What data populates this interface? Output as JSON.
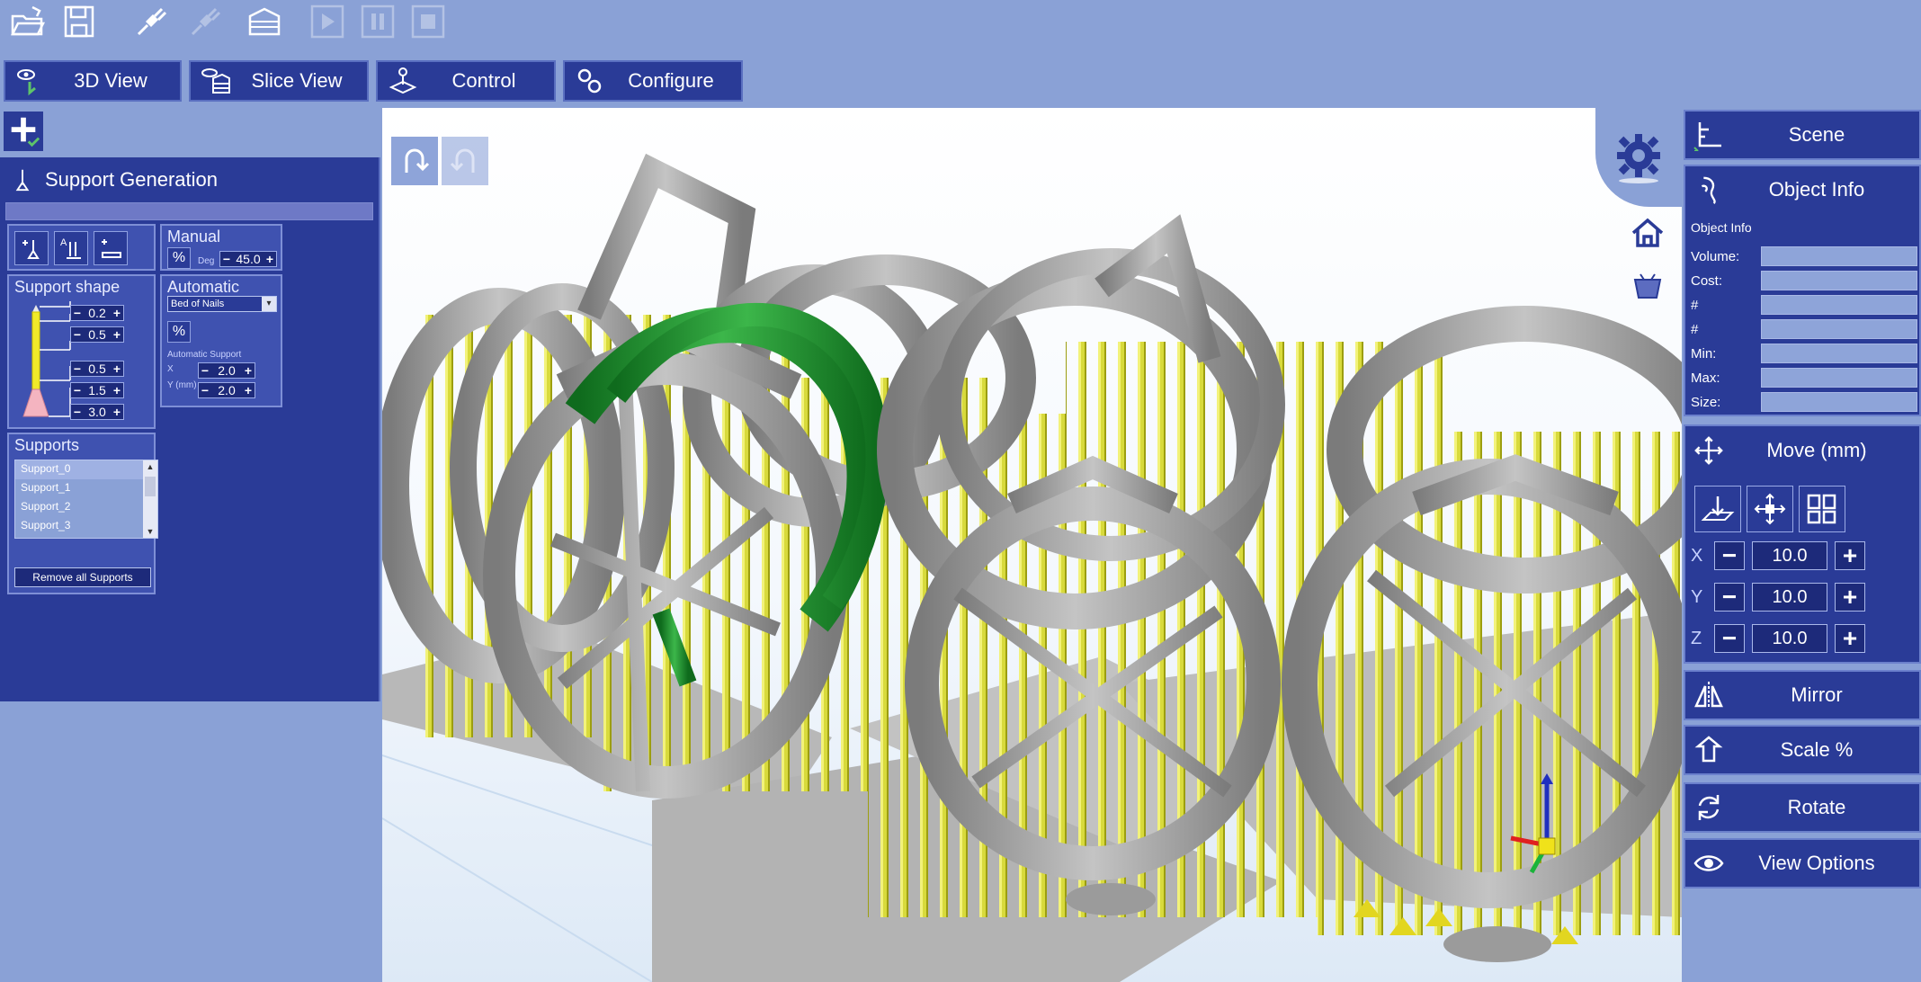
{
  "toolbar": {
    "buttons": [
      {
        "name": "open-folder-icon",
        "enabled": true
      },
      {
        "name": "save-icon",
        "enabled": true
      },
      {
        "name": "connect-icon",
        "enabled": true
      },
      {
        "name": "disconnect-icon",
        "enabled": false
      },
      {
        "name": "slice-layers-icon",
        "enabled": true
      },
      {
        "name": "play-icon",
        "enabled": false
      },
      {
        "name": "pause-icon",
        "enabled": false
      },
      {
        "name": "stop-icon",
        "enabled": false
      }
    ]
  },
  "tabs": [
    {
      "label": "3D View",
      "icon": "eye-icon"
    },
    {
      "label": "Slice View",
      "icon": "slice-icon"
    },
    {
      "label": "Control",
      "icon": "joystick-icon"
    },
    {
      "label": "Configure",
      "icon": "gears-icon"
    }
  ],
  "support_panel": {
    "title": "Support Generation",
    "support_shape": {
      "title": "Support shape",
      "values": [
        "0.2",
        "0.5",
        "0.5",
        "1.5",
        "3.0"
      ]
    },
    "manual": {
      "title": "Manual",
      "deg_label": "Deg",
      "deg_value": "45.0"
    },
    "automatic": {
      "title": "Automatic",
      "mode": "Bed of Nails",
      "auto_support_label": "Automatic Support",
      "x_label": "X",
      "y_label": "Y (mm)",
      "x_value": "2.0",
      "y_value": "2.0"
    },
    "supports": {
      "title": "Supports",
      "items": [
        "Support_0",
        "Support_1",
        "Support_2",
        "Support_3"
      ],
      "remove_label": "Remove all Supports"
    }
  },
  "right_panel": {
    "scene_label": "Scene",
    "object_info": {
      "title": "Object Info",
      "subtitle": "Object Info",
      "fields": [
        "Volume:",
        "Cost:",
        "#",
        "#",
        "Min:",
        "Max:",
        "Size:"
      ]
    },
    "move": {
      "title": "Move (mm)",
      "x_label": "X",
      "x_value": "10.0",
      "y_label": "Y",
      "y_value": "10.0",
      "z_label": "Z",
      "z_value": "10.0"
    },
    "mirror_label": "Mirror",
    "scale_label": "Scale %",
    "rotate_label": "Rotate",
    "view_options_label": "View Options"
  },
  "colors": {
    "background": "#8aa1d6",
    "panel": "#2a3b97",
    "selected_model": "#1f8a2a",
    "model": "#9a9a9a",
    "supports": "#d7d93a"
  }
}
